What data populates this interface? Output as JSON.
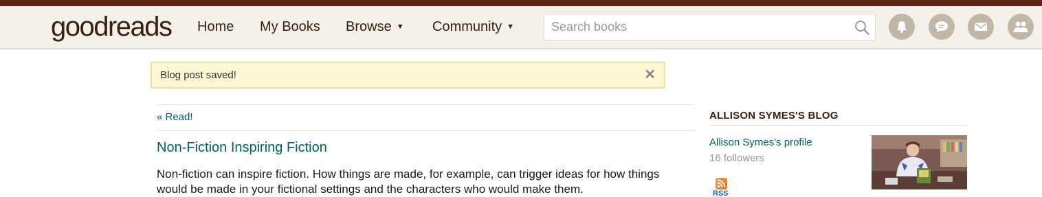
{
  "header": {
    "logo": {
      "good": "good",
      "reads": "reads"
    },
    "nav": [
      {
        "label": "Home"
      },
      {
        "label": "My Books"
      },
      {
        "label": "Browse",
        "caret": "▼"
      },
      {
        "label": "Community",
        "caret": "▼"
      }
    ],
    "search": {
      "placeholder": "Search books",
      "value": ""
    },
    "icons": [
      "bell-icon",
      "chat-icon",
      "mail-icon",
      "friends-icon"
    ]
  },
  "flash": {
    "message": "Blog post saved!",
    "close": "✕"
  },
  "post": {
    "back_link": "« Read!",
    "title": "Non-Fiction Inspiring Fiction",
    "body": "Non-fiction can inspire fiction. How things are made, for example, can trigger ideas for how things would be made in your fictional settings and the characters who would make them."
  },
  "sidebar": {
    "title": "ALLISON SYMES'S BLOG",
    "profile_link": "Allison Symes's profile",
    "followers": "16 followers",
    "rss_label": "RSS"
  },
  "colors": {
    "topbar": "#5c2415",
    "header_bg": "#f4f1ea",
    "brand_text": "#382110",
    "link": "#00635d",
    "flash_bg": "#fcf8d3",
    "icon_circle": "#c1b7a6"
  }
}
